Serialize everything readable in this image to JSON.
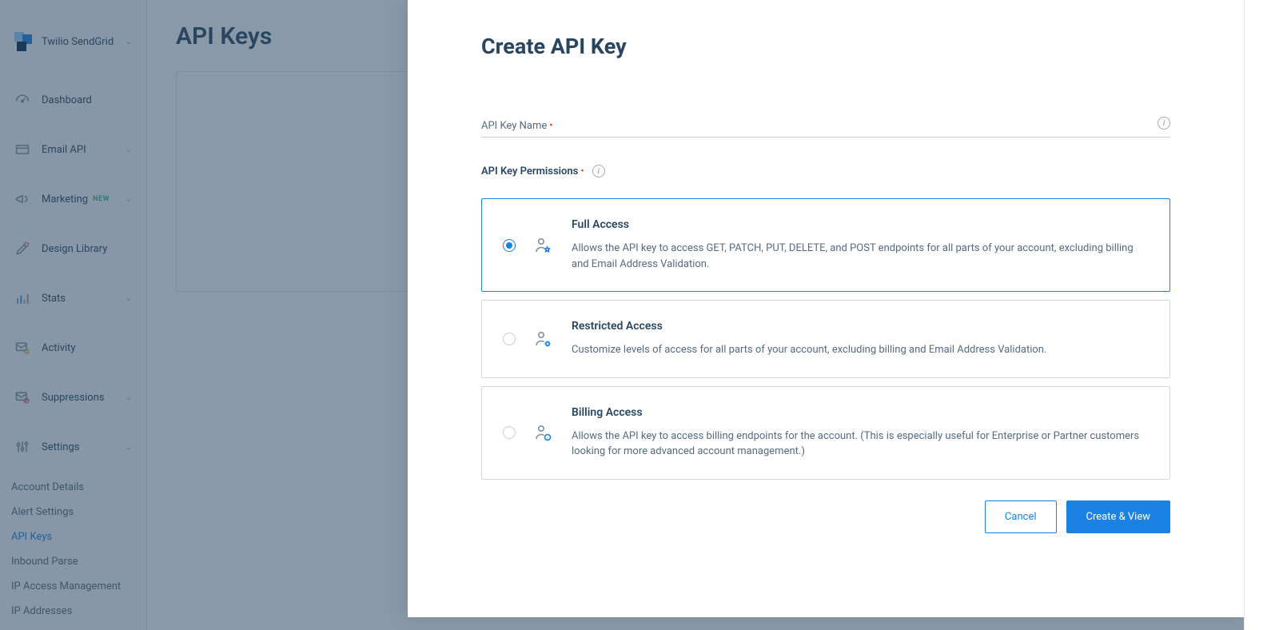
{
  "brand": {
    "name": "Twilio SendGrid"
  },
  "sidebar": {
    "items": [
      {
        "label": "Dashboard",
        "hasChevron": false
      },
      {
        "label": "Email API",
        "hasChevron": true
      },
      {
        "label": "Marketing",
        "badge": "NEW",
        "hasChevron": true
      },
      {
        "label": "Design Library",
        "hasChevron": false
      },
      {
        "label": "Stats",
        "hasChevron": true
      },
      {
        "label": "Activity",
        "hasChevron": false
      },
      {
        "label": "Suppressions",
        "hasChevron": true
      },
      {
        "label": "Settings",
        "hasChevron": true
      }
    ],
    "subnav": [
      "Account Details",
      "Alert Settings",
      "API Keys",
      "Inbound Parse",
      "IP Access Management",
      "IP Addresses"
    ],
    "active_sub_index": 2
  },
  "page": {
    "title": "API Keys"
  },
  "modal": {
    "title": "Create API Key",
    "name_label": "API Key Name",
    "perm_label": "API Key Permissions",
    "options": [
      {
        "title": "Full Access",
        "desc": "Allows the API key to access GET, PATCH, PUT, DELETE, and POST endpoints for all parts of your account, excluding billing and Email Address Validation."
      },
      {
        "title": "Restricted Access",
        "desc": "Customize levels of access for all parts of your account, excluding billing and Email Address Validation."
      },
      {
        "title": "Billing Access",
        "desc": "Allows the API key to access billing endpoints for the account. (This is especially useful for Enterprise or Partner customers looking for more advanced account management.)"
      }
    ],
    "selected_option": 0,
    "cancel": "Cancel",
    "submit": "Create & View"
  }
}
